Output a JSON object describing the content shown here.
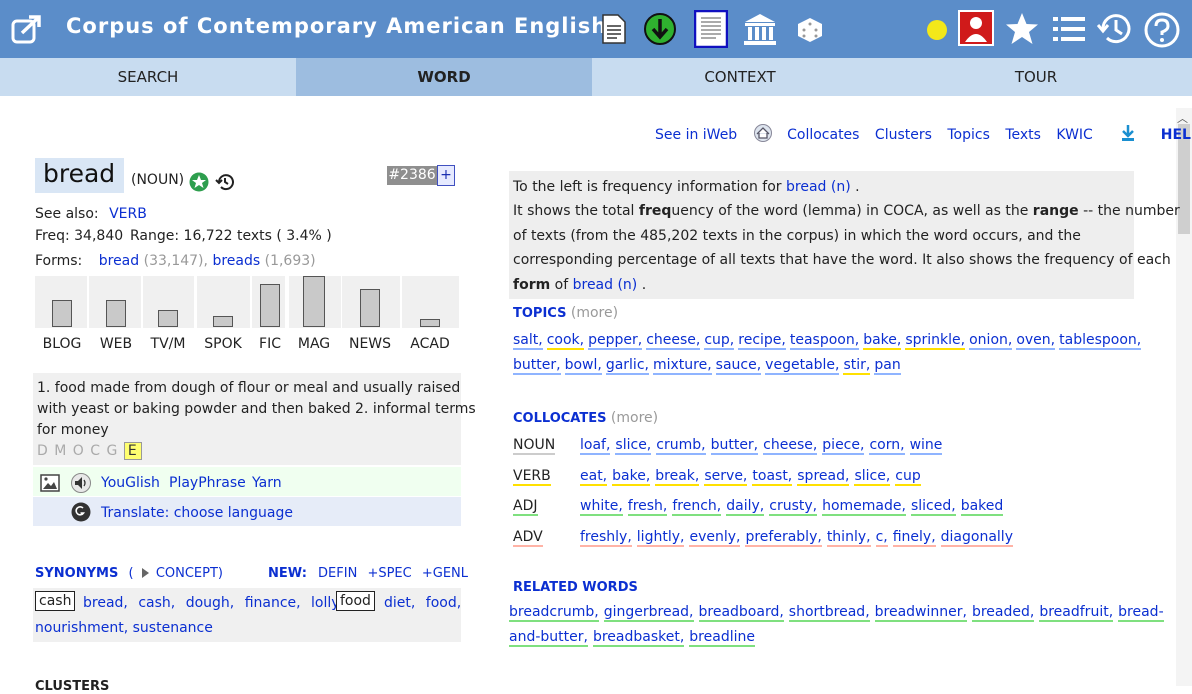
{
  "app": {
    "title": "Corpus of Contemporary American English"
  },
  "toolbar_icons": [
    "external-link-icon",
    "document-icon",
    "download-icon",
    "page-icon",
    "museum-icon",
    "dice-icon",
    "yellow-dot-icon",
    "user-icon",
    "star-icon",
    "list-icon",
    "history-icon",
    "help-icon"
  ],
  "tabs": [
    {
      "label": "SEARCH"
    },
    {
      "label": "WORD"
    },
    {
      "label": "CONTEXT"
    },
    {
      "label": "TOUR"
    }
  ],
  "topnav": {
    "iweb": "See in iWeb",
    "collocates": "Collocates",
    "clusters": "Clusters",
    "topics": "Topics",
    "texts": "Texts",
    "kwic": "KWIC",
    "help": "HELP"
  },
  "word": {
    "headword": "bread",
    "pos": "(NOUN)",
    "rank": "#2386",
    "plus": "+",
    "see_also_label": "See also:",
    "see_also": "VERB",
    "freq": "Freq: 34,840",
    "range": "Range: 16,722 texts ( 3.4% )",
    "forms_label": "Forms:",
    "forms": [
      {
        "form": "bread",
        "count": "(33,147),"
      },
      {
        "form": "breads",
        "count": "(1,693)"
      }
    ]
  },
  "genres": [
    {
      "label": "BLOG",
      "value": 0.52
    },
    {
      "label": "WEB",
      "value": 0.52
    },
    {
      "label": "TV/M",
      "value": 0.34
    },
    {
      "label": "SPOK",
      "value": 0.22
    },
    {
      "label": "FIC",
      "value": 0.84
    },
    {
      "label": "MAG",
      "value": 1.0
    },
    {
      "label": "NEWS",
      "value": 0.74
    },
    {
      "label": "ACAD",
      "value": 0.16
    }
  ],
  "definition": {
    "line1": "1. food made from dough of flour or meal and usually raised",
    "line2": "with yeast or baking powder and then baked 2. informal terms",
    "line3": "for money",
    "sources": [
      "D",
      "M",
      "O",
      "C",
      "G"
    ],
    "source_selected": "E"
  },
  "media": {
    "youglish": "YouGlish",
    "playphrase": "PlayPhrase",
    "yarn": "Yarn",
    "translate": "Translate: choose language"
  },
  "synonyms": {
    "title": "SYNONYMS",
    "open_paren": "(",
    "concept": "CONCEPT)",
    "new_label": "NEW:",
    "defin": "DEFIN",
    "spec": "+SPEC",
    "genl": "+GENL",
    "box1": "cash",
    "row1": [
      "bread,",
      "cash,",
      "dough,",
      "finance,",
      "lolly"
    ],
    "box2": "food",
    "row1b": [
      "diet,",
      "food,"
    ],
    "row2": [
      "nourishment,",
      "sustenance"
    ]
  },
  "info": {
    "l1a": "To the left  is frequency information for ",
    "l1link": "bread (n)",
    "l1b": " .",
    "l2a": "It shows the total ",
    "l2b": "freq",
    "l2c": "uency of the word (lemma) in COCA, as well as the ",
    "l2d": "range",
    "l2e": " -- the number",
    "l3": "of texts (from the 485,202 texts in the corpus) in which the word occurs, and the",
    "l4": "corresponding percentage of all texts that have the word. It also shows the frequency of each",
    "l5a": "form",
    "l5b": " of ",
    "l5link": "bread (n)",
    "l5c": " ."
  },
  "topics": {
    "title": "TOPICS",
    "more": "(more)",
    "row1": [
      "salt,",
      "cook,",
      "pepper,",
      "cheese,",
      "cup,",
      "recipe,",
      "teaspoon,",
      "bake,",
      "sprinkle,",
      "onion,",
      "oven,",
      "tablespoon,"
    ],
    "row2": [
      "butter,",
      "bowl,",
      "garlic,",
      "mixture,",
      "sauce,",
      "vegetable,",
      "stir,",
      "pan"
    ]
  },
  "collocates": {
    "title": "COLLOCATES",
    "more": "(more)",
    "rows": [
      {
        "pos": "NOUN",
        "words": [
          "loaf,",
          "slice,",
          "crumb,",
          "butter,",
          "cheese,",
          "piece,",
          "corn,",
          "wine"
        ]
      },
      {
        "pos": "VERB",
        "words": [
          "eat,",
          "bake,",
          "break,",
          "serve,",
          "toast,",
          "spread,",
          "slice,",
          "cup"
        ]
      },
      {
        "pos": "ADJ",
        "words": [
          "white,",
          "fresh,",
          "french,",
          "daily,",
          "crusty,",
          "homemade,",
          "sliced,",
          "baked"
        ]
      },
      {
        "pos": "ADV",
        "words": [
          "freshly,",
          "lightly,",
          "evenly,",
          "preferably,",
          "thinly,",
          "c,",
          "finely,",
          "diagonally"
        ]
      }
    ]
  },
  "related": {
    "title": "RELATED WORDS",
    "row1": [
      "breadcrumb,",
      "gingerbread,",
      "breadboard,",
      "shortbread,",
      "breadwinner,",
      "breaded,",
      "breadfruit,",
      "bread-"
    ],
    "row2": [
      "and-butter,",
      "breadbasket,",
      "breadline"
    ]
  },
  "clusters_partial": "CLUSTERS",
  "colors": {
    "topbar": "#5b8dc9",
    "tabs": "#c8dcf0",
    "tab_active": "#9dbde0",
    "link": "#0b2fd1"
  }
}
